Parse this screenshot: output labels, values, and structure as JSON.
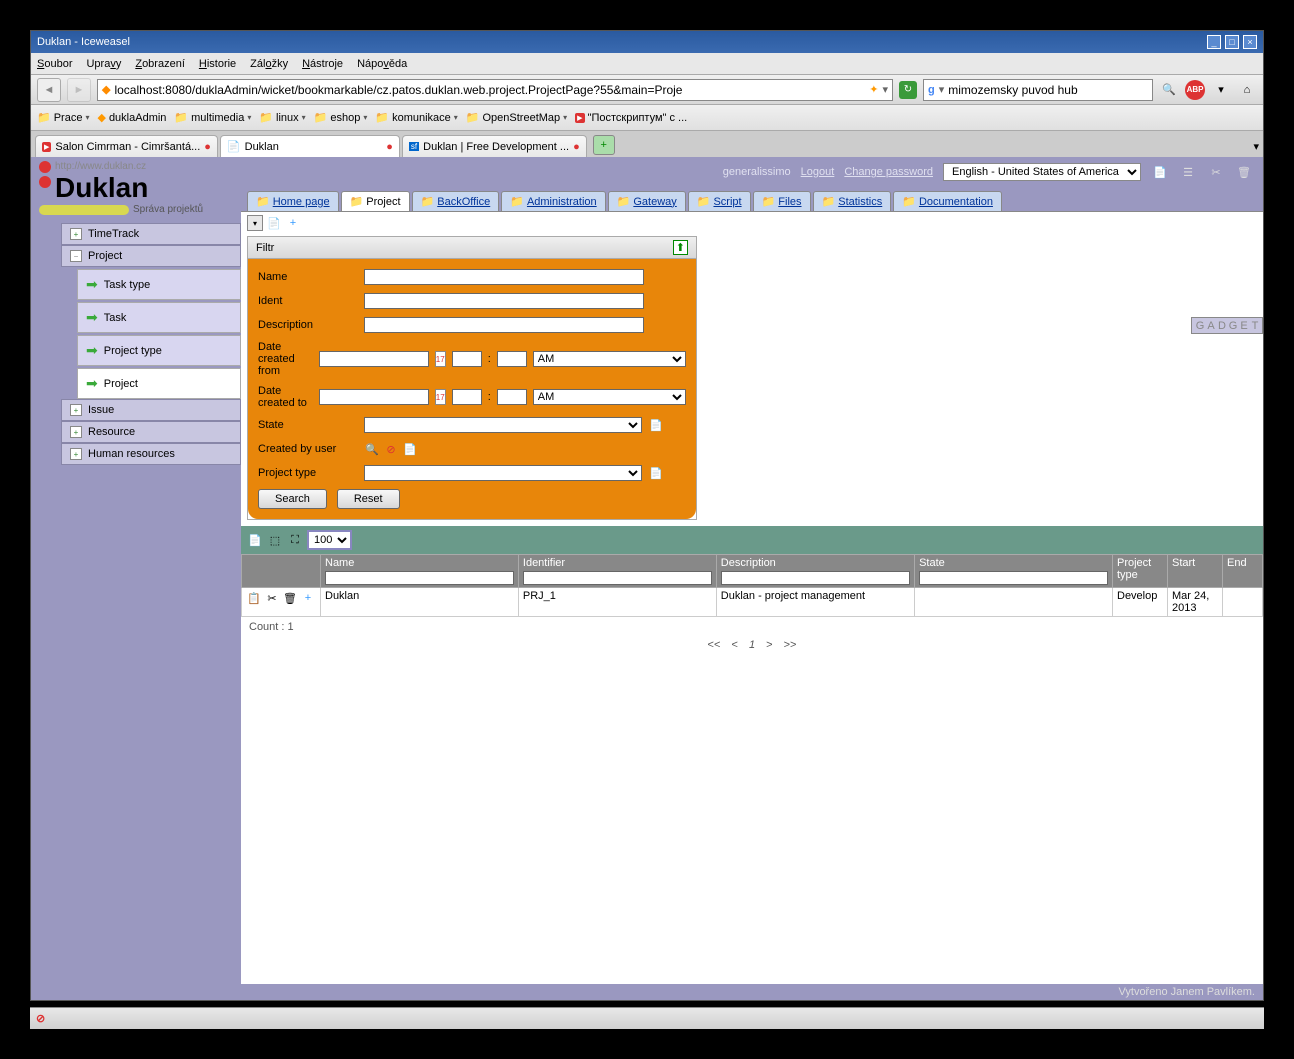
{
  "window": {
    "title": "Duklan - Iceweasel"
  },
  "menubar": [
    "Soubor",
    "Upravy",
    "Zobrazení",
    "Historie",
    "Záložky",
    "Nástroje",
    "Nápověda"
  ],
  "url": "localhost:8080/duklaAdmin/wicket/bookmarkable/cz.patos.duklan.web.project.ProjectPage?55&main=Proje",
  "searchbox": "mimozemsky puvod hub",
  "bookmarks": [
    "Prace",
    "duklaAdmin",
    "multimedia",
    "linux",
    "eshop",
    "komunikace",
    "OpenStreetMap",
    "\"Постскриптум\" с ..."
  ],
  "tabs": [
    {
      "title": "Salon Cimrman - Cimršantá...",
      "icon": "yt"
    },
    {
      "title": "Duklan",
      "icon": "page",
      "active": true
    },
    {
      "title": "Duklan | Free Development ...",
      "icon": "sf"
    }
  ],
  "brand": {
    "url": "http://www.duklan.cz",
    "name": "Duklan",
    "sub": "Správa projektů"
  },
  "sidenav": {
    "items": [
      "TimeTrack",
      "Project",
      "Issue",
      "Resource",
      "Human resources"
    ],
    "expanded": "Project",
    "subitems": [
      "Task type",
      "Task",
      "Project type",
      "Project"
    ],
    "active_sub": "Project"
  },
  "topbar": {
    "user": "generalissimo",
    "logout": "Logout",
    "change_pw": "Change password",
    "lang": "English - United States of America"
  },
  "maintabs": [
    "Home page",
    "Project",
    "BackOffice",
    "Administration",
    "Gateway",
    "Script",
    "Files",
    "Statistics",
    "Documentation"
  ],
  "maintab_active": "Project",
  "filter": {
    "title": "Filtr",
    "labels": {
      "name": "Name",
      "ident": "Ident",
      "desc": "Description",
      "dfrom": "Date created from",
      "dto": "Date created to",
      "state": "State",
      "cby": "Created by user",
      "ptype": "Project type"
    },
    "ampm": "AM",
    "search": "Search",
    "reset": "Reset"
  },
  "pagesize": "100",
  "grid": {
    "headers": [
      "Name",
      "Identifier",
      "Description",
      "State",
      "Project type",
      "Start",
      "End"
    ],
    "row": {
      "name": "Duklan",
      "ident": "PRJ_1",
      "desc": "Duklan - project management",
      "state": "",
      "ptype": "Develop",
      "start": "Mar 24, 2013",
      "end": ""
    }
  },
  "count": "Count : 1",
  "pager": [
    "<<",
    "<",
    "1",
    ">",
    ">>"
  ],
  "gadget": "GADGET",
  "footer": "Vytvořeno Janem Pavlíkem."
}
